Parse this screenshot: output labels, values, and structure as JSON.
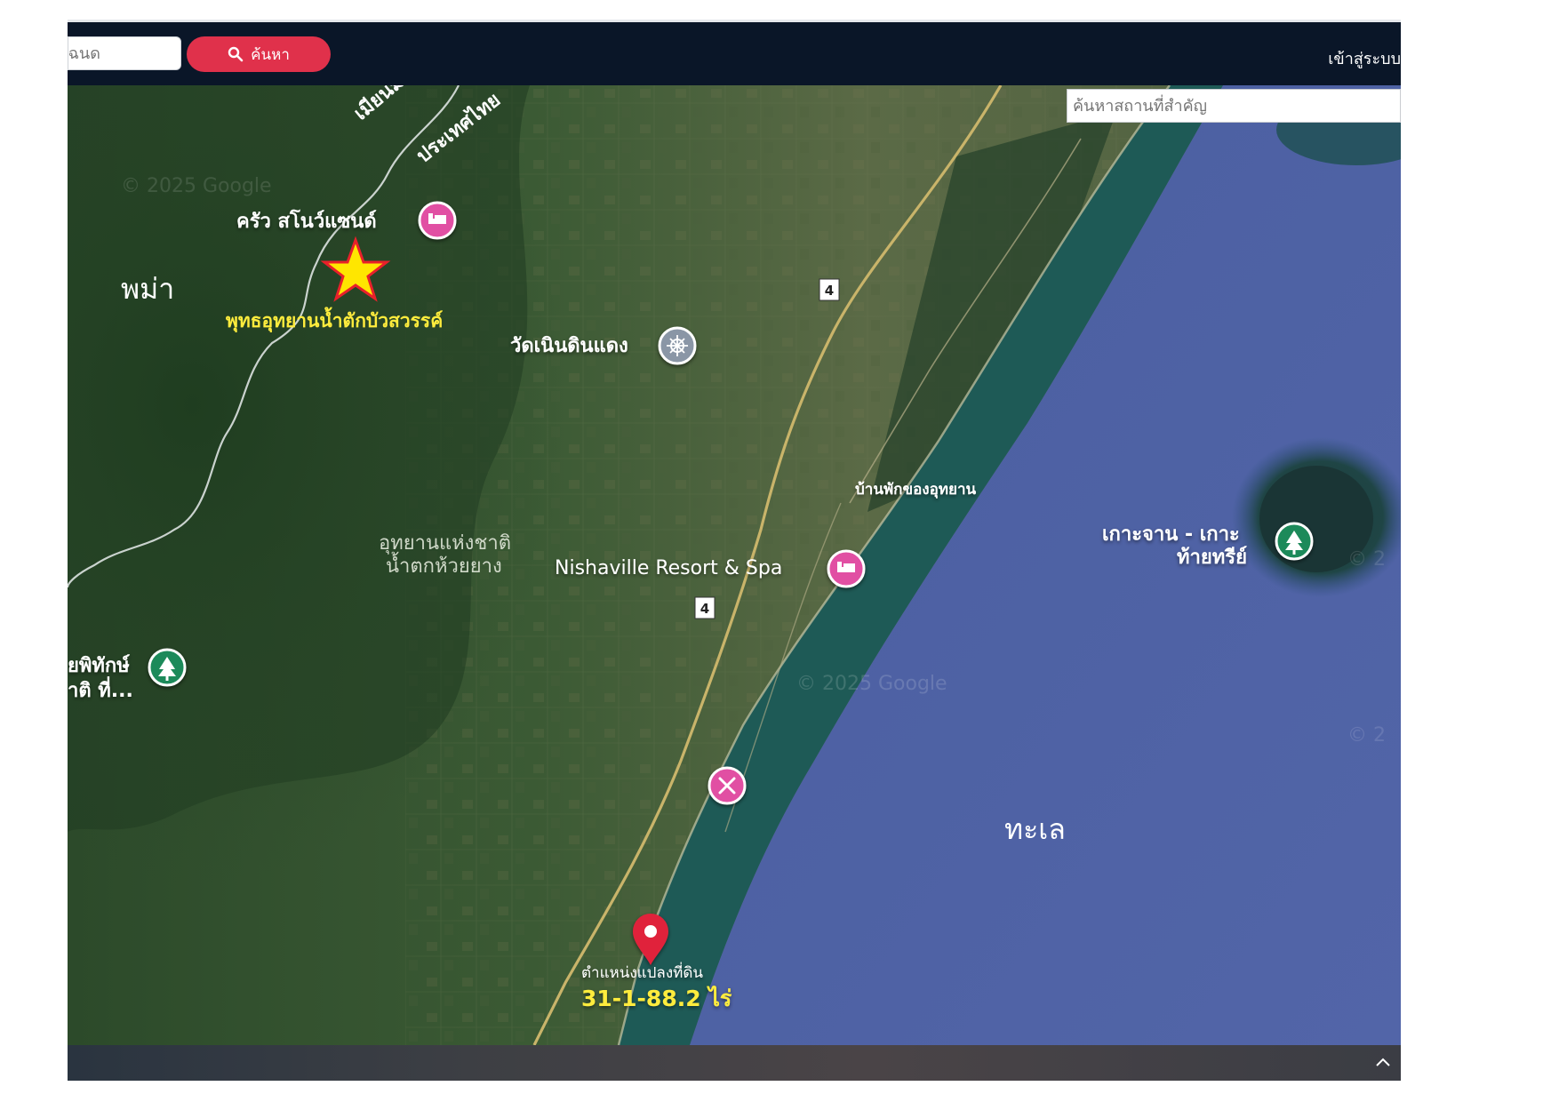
{
  "topbar": {
    "deed_placeholder": "โฉนด",
    "search_button_label": "ค้นหา",
    "login_label": "เข้าสู่ระบบ"
  },
  "map": {
    "place_search_placeholder": "ค้นหาสถานที่สำคัญ",
    "labels": {
      "myanmar_border": "เมียนมา",
      "country_thailand": "ประเทศไทย",
      "snow_sand": "ครัว สโนว์แซนด์",
      "myanmar": "พม่า",
      "buddha_park": "พุทธอุทยานน้ำตักบัวสวรรค์",
      "wat": "วัดเนินดินแดง",
      "park_house": "บ้านพักของอุทยาน",
      "national_park_1": "อุทยานแห่งชาติ",
      "national_park_2": "น้ำตกห้วยยาง",
      "resort": "Nishaville Resort & Spa",
      "island_1": "เกาะจาน - เกาะ",
      "island_2": "ท้ายทรีย์",
      "wildlife_1": "ยพิทักษ์",
      "wildlife_2": "าติ ที่...",
      "sea": "ทะเล",
      "land_plot": "ตำแหน่งแปลงที่ดิน",
      "area": "31-1-88.2 ไร่",
      "road_4_north": "4",
      "road_4_south": "4",
      "watermark_1": "© 2025 Google",
      "watermark_2": "© 2025 Google",
      "watermark_3": "© 2",
      "watermark_4": "© 2"
    },
    "colors": {
      "forest": "#2f4d2b",
      "farmland": "#5d6b45",
      "sea": "#4f63a6",
      "shallow_water": "#1f5a5a",
      "poi_pink": "#e14fa3",
      "poi_green": "#1f8a5a",
      "pin_red": "#e0243b",
      "star_fill": "#ffe600",
      "star_stroke": "#e8202a",
      "highlight_yellow": "#ffec3d"
    }
  }
}
